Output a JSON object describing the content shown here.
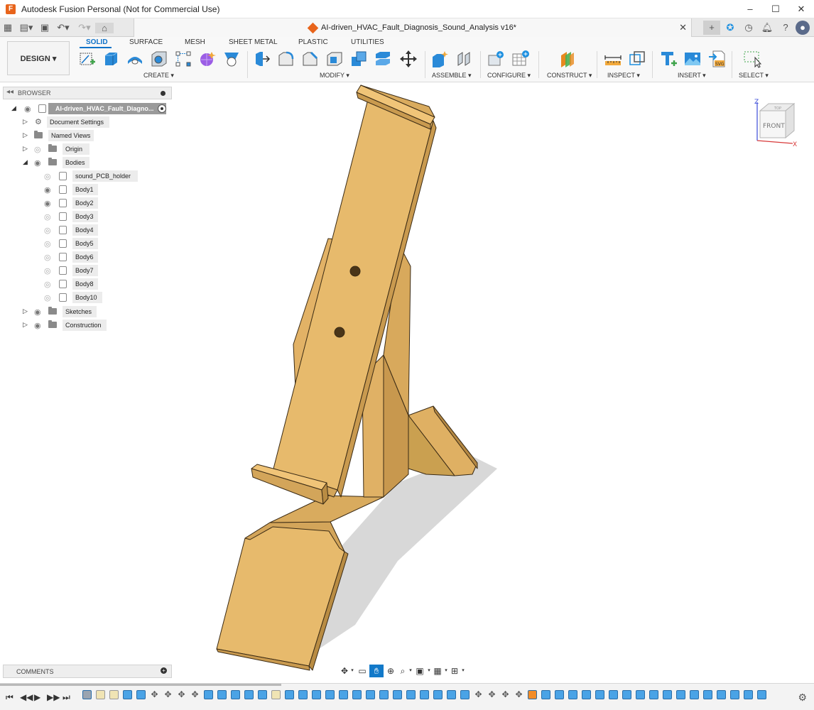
{
  "titlebar": {
    "title": "Autodesk Fusion Personal (Not for Commercial Use)",
    "minimize": "–",
    "maximize": "☐",
    "close": "✕"
  },
  "tabbar": {
    "doc_title": "AI-driven_HVAC_Fault_Diagnosis_Sound_Analysis v16*",
    "close": "✕"
  },
  "toolbar": {
    "design_label": "DESIGN ▾",
    "workspace_tabs": [
      "SOLID",
      "SURFACE",
      "MESH",
      "SHEET METAL",
      "PLASTIC",
      "UTILITIES"
    ],
    "groups": {
      "create": "CREATE ▾",
      "modify": "MODIFY ▾",
      "assemble": "ASSEMBLE ▾",
      "configure": "CONFIGURE ▾",
      "construct": "CONSTRUCT ▾",
      "inspect": "INSPECT ▾",
      "insert": "INSERT ▾",
      "select": "SELECT ▾"
    },
    "colors": {
      "accent": "#0f72c8",
      "solid_blue": "#2a8ad8",
      "construct_orange": "#e8891e",
      "construct_green": "#4caf50",
      "insert_green": "#3ea34a"
    }
  },
  "browser": {
    "title": "BROWSER",
    "root": "AI-driven_HVAC_Fault_Diagno...",
    "items": {
      "document_settings": "Document Settings",
      "named_views": "Named Views",
      "origin": "Origin",
      "bodies": "Bodies",
      "sketches": "Sketches",
      "construction": "Construction"
    },
    "bodies": [
      "sound_PCB_holder",
      "Body1",
      "Body2",
      "Body3",
      "Body4",
      "Body5",
      "Body6",
      "Body7",
      "Body8",
      "Body10"
    ]
  },
  "viewcube": {
    "face_front": "FRONT",
    "face_top": "TOP",
    "axis_z": "Z",
    "axis_x": "X"
  },
  "comments": {
    "title": "COMMENTS"
  },
  "model": {
    "color": "#e8b96a",
    "shadow": "#cfcfcf"
  }
}
